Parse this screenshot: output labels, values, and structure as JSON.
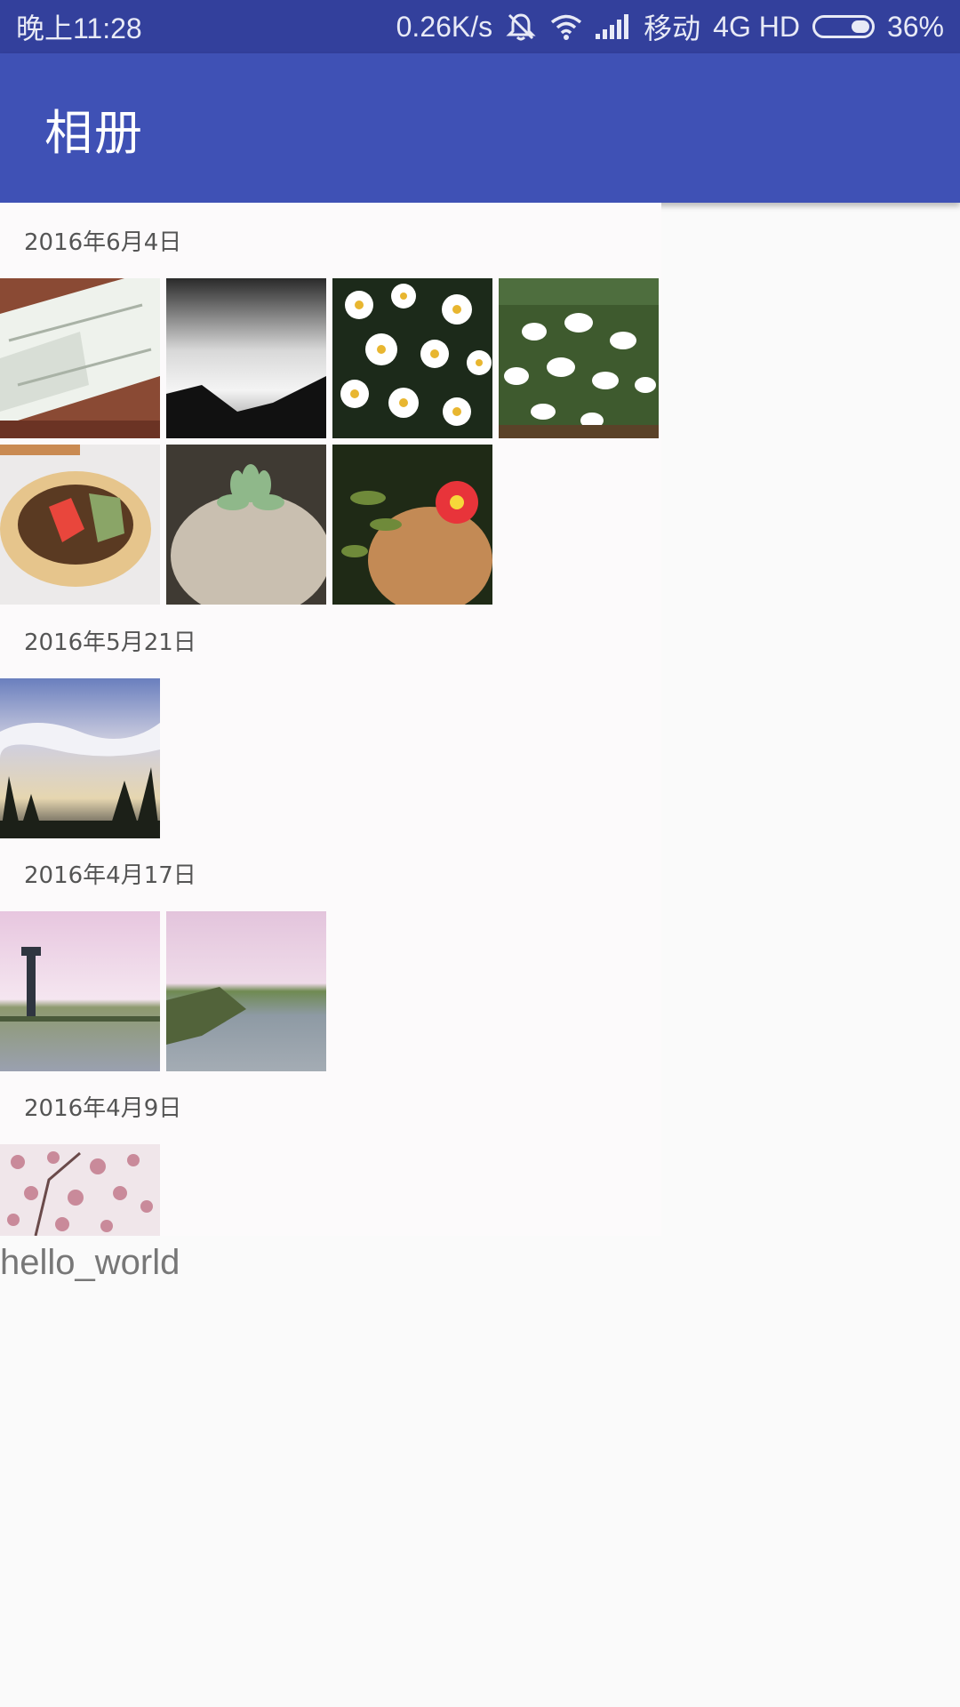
{
  "status_bar": {
    "time": "晚上11:28",
    "speed": "0.26K/s",
    "carrier": "移动",
    "network": "4G HD",
    "battery_level": "36%",
    "icons": [
      "mute-icon",
      "wifi-icon",
      "signal-icon",
      "battery-icon"
    ]
  },
  "appbar": {
    "title": "相册"
  },
  "album": {
    "groups": [
      {
        "date": "2016年6月4日",
        "photo_count": 7
      },
      {
        "date": "2016年5月21日",
        "photo_count": 1
      },
      {
        "date": "2016年4月17日",
        "photo_count": 2
      },
      {
        "date": "2016年4月9日",
        "photo_count": 1
      }
    ]
  },
  "footer_text": "hello_world",
  "colors": {
    "status_bar": "#33409c",
    "app_bar": "#3f51b5",
    "background": "#fafafa"
  }
}
